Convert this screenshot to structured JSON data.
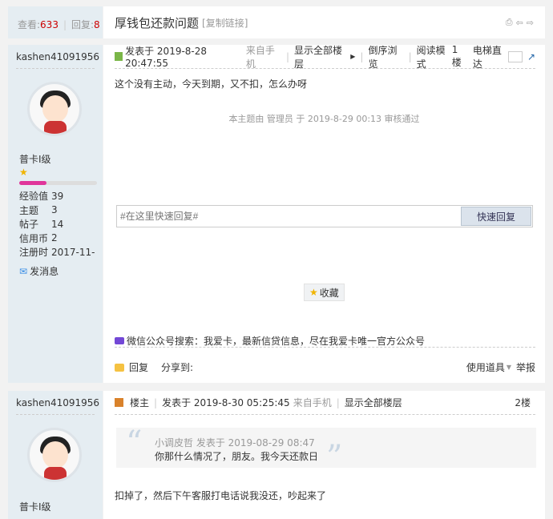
{
  "header": {
    "views_label": "查看:",
    "views": "633",
    "replies_label": "回复:",
    "replies": "8",
    "title": "厚钱包还款问题",
    "copy_link": "[复制链接]"
  },
  "post1": {
    "author": "kashen41091956",
    "posted": "发表于 2019-8-28 20:47:55",
    "from": "来自手机",
    "show_all": "显示全部楼层",
    "reverse": "倒序浏览",
    "read_mode": "阅读模式",
    "floor": "1楼",
    "elevator": "电梯直达",
    "content": "这个没有主动，今天到期，又不扣，怎么办呀",
    "moderation": "本主题由 管理员 于 2019-8-29 00:13 审核通过",
    "reply_placeholder": "#在这里快速回复#",
    "quick_reply": "快速回复",
    "favorite": "收藏",
    "wechat": "微信公众号搜索：我爱卡，最新信贷信息，尽在我爱卡唯一官方公众号",
    "reply": "回复",
    "share": "分享到:",
    "tools": "使用道具",
    "report": "举报"
  },
  "user1": {
    "level": "普卡I级",
    "level_progress": 0.35,
    "stats": [
      {
        "k": "经验值",
        "v": "39"
      },
      {
        "k": "主题",
        "v": "3"
      },
      {
        "k": "帖子",
        "v": "14"
      },
      {
        "k": "信用币",
        "v": "2"
      },
      {
        "k": "注册时",
        "v": "2017-11-"
      }
    ],
    "message": "发消息"
  },
  "post2": {
    "author": "kashen41091956",
    "op": "楼主",
    "posted": "发表于 2019-8-30 05:25:45",
    "from": "来自手机",
    "show_all": "显示全部楼层",
    "floor": "2楼",
    "quote_author": "小调皮哲 发表于 2019-08-29 08:47",
    "quote_text": "你那什么情况了，朋友。我今天还款日",
    "content": "扣掉了，然后下午客服打电话说我没还，吵起来了",
    "level": "普卡I级"
  },
  "colors": {
    "accent": "#c00",
    "progress": "#e0359a",
    "sidebar": "#e5edf2"
  }
}
